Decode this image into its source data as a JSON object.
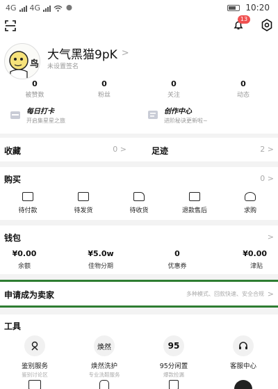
{
  "status_bar": {
    "carrier_left": "4G",
    "carrier_right": "4G",
    "time": "10:20"
  },
  "header": {
    "scan_icon": "scan-icon",
    "notification_badge": "13",
    "settings_icon": "gear-icon"
  },
  "profile": {
    "name": "大气黑猫9pK",
    "signature": "未设置签名",
    "avatar_caption": "鸟"
  },
  "stats": [
    {
      "value": "0",
      "label": "被赞数"
    },
    {
      "value": "0",
      "label": "粉丝"
    },
    {
      "value": "0",
      "label": "关注"
    },
    {
      "value": "0",
      "label": "动态"
    }
  ],
  "promo": [
    {
      "title": "每日打卡",
      "subtitle": "开启集星星之旅"
    },
    {
      "title": "创作中心",
      "subtitle": "进阶秘诀更新啦~"
    }
  ],
  "collections": {
    "favorites_label": "收藏",
    "favorites_count": "0",
    "footprint_label": "足迹",
    "footprint_count": "2"
  },
  "purchases": {
    "title": "购买",
    "count": "0",
    "items": [
      "待付款",
      "待发货",
      "待收货",
      "退款售后",
      "求购"
    ]
  },
  "wallet": {
    "title": "钱包",
    "items": [
      {
        "value": "¥0.00",
        "label": "余额"
      },
      {
        "value": "¥5.0w",
        "label": "佳物分期"
      },
      {
        "value": "0",
        "label": "优惠券"
      },
      {
        "value": "¥0.00",
        "label": "津贴"
      }
    ]
  },
  "seller": {
    "title": "申请成为卖家",
    "subtitle": "多种模式、回款快速、安全合规"
  },
  "tools": {
    "title": "工具",
    "items": [
      {
        "glyph": "",
        "label": "鉴别服务",
        "sub": "鉴别讨论区"
      },
      {
        "glyph": "焕然",
        "label": "焕然洗护",
        "sub": "专业洗鞋服务"
      },
      {
        "glyph": "95",
        "label": "95分闲置",
        "sub": "爆款捡漏"
      },
      {
        "glyph": "",
        "label": "客服中心",
        "sub": ""
      }
    ]
  },
  "colors": {
    "highlight_border": "#2e7d32",
    "badge": "#f05050"
  }
}
